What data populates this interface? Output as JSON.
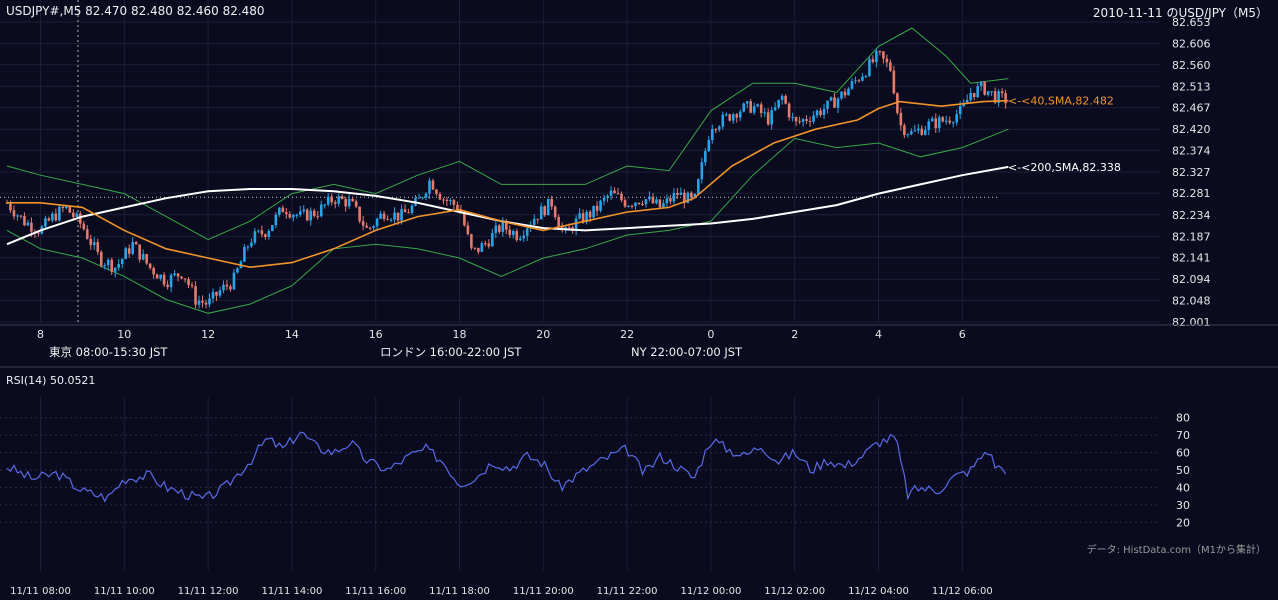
{
  "header": {
    "symbol_line": "USDJPY#,M5 82.470 82.480 82.460 82.480",
    "title": "2010-11-11 のUSD/JPY（M5）"
  },
  "colors": {
    "background": "#0a0b1f",
    "grid": "#1c1f38",
    "up_candle": "#2aa3e6",
    "down_candle": "#e57b6c",
    "sma40": "#f0932b",
    "sma200": "#ffffff",
    "bollinger": "#39a84a",
    "rsi": "#5a6ae6",
    "tokyo": "#25507e",
    "london": "#7e5417",
    "ny": "#27613c"
  },
  "sessions": [
    {
      "label": "東京 08:00-15:30 JST",
      "color": "#25507e"
    },
    {
      "label": "ロンドン 16:00-22:00 JST",
      "color": "#7e5417"
    },
    {
      "label": "NY 22:00-07:00 JST",
      "color": "#27613c"
    }
  ],
  "annotations": {
    "sma40": "<-<40,SMA,82.482",
    "sma200": "<-<200,SMA,82.338"
  },
  "rsi": {
    "label": "RSI(14) 50.0521",
    "ticks": [
      "20",
      "30",
      "40",
      "50",
      "60",
      "70",
      "80"
    ]
  },
  "credit": "データ: HistData.com（M1から集計）",
  "chart_data": [
    {
      "type": "candlestick",
      "title": "2010-11-11 のUSD/JPY（M5）",
      "x_hour_labels": [
        "8",
        "10",
        "12",
        "14",
        "16",
        "18",
        "20",
        "22",
        "0",
        "2",
        "4",
        "6"
      ],
      "y_ticks": [
        "82.653",
        "82.606",
        "82.560",
        "82.513",
        "82.467",
        "82.420",
        "82.374",
        "82.327",
        "82.281",
        "82.234",
        "82.187",
        "82.141",
        "82.094",
        "82.048",
        "82.001"
      ],
      "ylim": [
        82.001,
        82.653
      ],
      "close_path": [
        [
          7.2,
          82.26
        ],
        [
          7.6,
          82.22
        ],
        [
          8.0,
          82.2
        ],
        [
          8.3,
          82.23
        ],
        [
          8.6,
          82.25
        ],
        [
          9.0,
          82.21
        ],
        [
          9.4,
          82.14
        ],
        [
          9.8,
          82.12
        ],
        [
          10.2,
          82.17
        ],
        [
          10.6,
          82.12
        ],
        [
          11.0,
          82.09
        ],
        [
          11.4,
          82.11
        ],
        [
          11.7,
          82.05
        ],
        [
          12.0,
          82.04
        ],
        [
          12.3,
          82.07
        ],
        [
          12.6,
          82.09
        ],
        [
          13.0,
          82.18
        ],
        [
          13.4,
          82.2
        ],
        [
          13.8,
          82.25
        ],
        [
          14.2,
          82.23
        ],
        [
          14.6,
          82.24
        ],
        [
          15.0,
          82.27
        ],
        [
          15.4,
          82.26
        ],
        [
          15.8,
          82.2
        ],
        [
          16.2,
          82.24
        ],
        [
          16.6,
          82.23
        ],
        [
          17.0,
          82.26
        ],
        [
          17.3,
          82.31
        ],
        [
          17.6,
          82.27
        ],
        [
          18.0,
          82.25
        ],
        [
          18.3,
          82.15
        ],
        [
          18.6,
          82.17
        ],
        [
          19.0,
          82.21
        ],
        [
          19.4,
          82.19
        ],
        [
          19.8,
          82.23
        ],
        [
          20.2,
          82.26
        ],
        [
          20.5,
          82.19
        ],
        [
          20.8,
          82.22
        ],
        [
          21.2,
          82.24
        ],
        [
          21.6,
          82.28
        ],
        [
          22.0,
          82.26
        ],
        [
          22.4,
          82.27
        ],
        [
          22.8,
          82.25
        ],
        [
          23.2,
          82.28
        ],
        [
          23.6,
          82.26
        ],
        [
          24.0,
          82.43
        ],
        [
          24.3,
          82.44
        ],
        [
          24.6,
          82.46
        ],
        [
          25.0,
          82.47
        ],
        [
          25.4,
          82.44
        ],
        [
          25.7,
          82.49
        ],
        [
          26.0,
          82.43
        ],
        [
          26.4,
          82.45
        ],
        [
          26.8,
          82.47
        ],
        [
          27.2,
          82.5
        ],
        [
          27.6,
          82.54
        ],
        [
          28.0,
          82.58
        ],
        [
          28.3,
          82.55
        ],
        [
          28.5,
          82.43
        ],
        [
          28.8,
          82.41
        ],
        [
          29.2,
          82.43
        ],
        [
          29.6,
          82.44
        ],
        [
          30.0,
          82.46
        ],
        [
          30.2,
          82.5
        ],
        [
          30.5,
          82.51
        ],
        [
          30.8,
          82.49
        ],
        [
          31.1,
          82.482
        ]
      ],
      "sma40_path": [
        [
          7.2,
          82.26
        ],
        [
          8.0,
          82.26
        ],
        [
          9.0,
          82.25
        ],
        [
          10.0,
          82.2
        ],
        [
          11.0,
          82.16
        ],
        [
          12.0,
          82.14
        ],
        [
          13.0,
          82.12
        ],
        [
          14.0,
          82.13
        ],
        [
          15.0,
          82.16
        ],
        [
          16.0,
          82.2
        ],
        [
          17.0,
          82.23
        ],
        [
          18.0,
          82.245
        ],
        [
          19.0,
          82.22
        ],
        [
          20.0,
          82.2
        ],
        [
          21.0,
          82.22
        ],
        [
          22.0,
          82.24
        ],
        [
          23.0,
          82.25
        ],
        [
          23.6,
          82.27
        ],
        [
          24.5,
          82.34
        ],
        [
          25.5,
          82.39
        ],
        [
          26.5,
          82.42
        ],
        [
          27.5,
          82.44
        ],
        [
          28.0,
          82.465
        ],
        [
          28.5,
          82.48
        ],
        [
          29.5,
          82.47
        ],
        [
          30.5,
          82.48
        ],
        [
          31.1,
          82.482
        ]
      ],
      "sma200_path": [
        [
          7.2,
          82.17
        ],
        [
          8.0,
          82.2
        ],
        [
          9.0,
          82.23
        ],
        [
          10.0,
          82.25
        ],
        [
          11.0,
          82.27
        ],
        [
          12.0,
          82.285
        ],
        [
          13.0,
          82.29
        ],
        [
          14.0,
          82.29
        ],
        [
          15.0,
          82.285
        ],
        [
          16.0,
          82.275
        ],
        [
          17.0,
          82.26
        ],
        [
          18.0,
          82.24
        ],
        [
          19.0,
          82.22
        ],
        [
          20.0,
          82.205
        ],
        [
          21.0,
          82.2
        ],
        [
          22.0,
          82.205
        ],
        [
          23.0,
          82.21
        ],
        [
          24.0,
          82.215
        ],
        [
          25.0,
          82.225
        ],
        [
          26.0,
          82.24
        ],
        [
          27.0,
          82.255
        ],
        [
          28.0,
          82.28
        ],
        [
          29.0,
          82.3
        ],
        [
          30.0,
          82.32
        ],
        [
          31.1,
          82.338
        ]
      ],
      "bollinger_upper_path": [
        [
          7.2,
          82.34
        ],
        [
          8.0,
          82.32
        ],
        [
          9.0,
          82.3
        ],
        [
          10.0,
          82.28
        ],
        [
          11.0,
          82.23
        ],
        [
          12.0,
          82.18
        ],
        [
          13.0,
          82.22
        ],
        [
          14.0,
          82.28
        ],
        [
          15.0,
          82.3
        ],
        [
          16.0,
          82.28
        ],
        [
          17.0,
          82.32
        ],
        [
          18.0,
          82.35
        ],
        [
          19.0,
          82.3
        ],
        [
          20.0,
          82.3
        ],
        [
          21.0,
          82.3
        ],
        [
          22.0,
          82.34
        ],
        [
          23.0,
          82.33
        ],
        [
          24.0,
          82.46
        ],
        [
          25.0,
          82.52
        ],
        [
          26.0,
          82.52
        ],
        [
          27.0,
          82.5
        ],
        [
          28.0,
          82.6
        ],
        [
          28.8,
          82.64
        ],
        [
          29.6,
          82.58
        ],
        [
          30.2,
          82.52
        ],
        [
          31.1,
          82.53
        ]
      ],
      "bollinger_lower_path": [
        [
          7.2,
          82.2
        ],
        [
          8.0,
          82.16
        ],
        [
          9.0,
          82.14
        ],
        [
          10.0,
          82.1
        ],
        [
          11.0,
          82.05
        ],
        [
          12.0,
          82.02
        ],
        [
          13.0,
          82.04
        ],
        [
          14.0,
          82.08
        ],
        [
          15.0,
          82.16
        ],
        [
          16.0,
          82.17
        ],
        [
          17.0,
          82.16
        ],
        [
          18.0,
          82.14
        ],
        [
          19.0,
          82.1
        ],
        [
          20.0,
          82.14
        ],
        [
          21.0,
          82.16
        ],
        [
          22.0,
          82.19
        ],
        [
          23.0,
          82.2
        ],
        [
          24.0,
          82.22
        ],
        [
          25.0,
          82.32
        ],
        [
          26.0,
          82.4
        ],
        [
          27.0,
          82.38
        ],
        [
          28.0,
          82.39
        ],
        [
          29.0,
          82.36
        ],
        [
          30.0,
          82.38
        ],
        [
          31.1,
          82.42
        ]
      ]
    },
    {
      "type": "line",
      "title": "RSI(14) 50.0521",
      "ylim": [
        15,
        85
      ],
      "y_ticks": [
        20,
        30,
        40,
        50,
        60,
        70,
        80
      ],
      "x_tick_labels": [
        "11/11 08:00",
        "11/11 10:00",
        "11/11 12:00",
        "11/11 14:00",
        "11/11 16:00",
        "11/11 18:00",
        "11/11 20:00",
        "11/11 22:00",
        "11/12 00:00",
        "11/12 02:00",
        "11/12 04:00",
        "11/12 06:00"
      ],
      "path": [
        [
          7.2,
          52
        ],
        [
          7.8,
          45
        ],
        [
          8.4,
          48
        ],
        [
          9.0,
          38
        ],
        [
          9.6,
          34
        ],
        [
          10.0,
          45
        ],
        [
          10.6,
          47
        ],
        [
          11.0,
          40
        ],
        [
          11.5,
          36
        ],
        [
          11.9,
          33
        ],
        [
          12.4,
          40
        ],
        [
          13.0,
          55
        ],
        [
          13.4,
          68
        ],
        [
          13.8,
          62
        ],
        [
          14.2,
          72
        ],
        [
          14.6,
          63
        ],
        [
          15.0,
          60
        ],
        [
          15.4,
          66
        ],
        [
          15.8,
          55
        ],
        [
          16.3,
          50
        ],
        [
          16.8,
          58
        ],
        [
          17.2,
          62
        ],
        [
          17.6,
          55
        ],
        [
          18.0,
          42
        ],
        [
          18.4,
          46
        ],
        [
          18.8,
          55
        ],
        [
          19.2,
          51
        ],
        [
          19.6,
          58
        ],
        [
          20.0,
          54
        ],
        [
          20.4,
          40
        ],
        [
          20.8,
          47
        ],
        [
          21.2,
          53
        ],
        [
          21.6,
          58
        ],
        [
          22.0,
          62
        ],
        [
          22.4,
          48
        ],
        [
          22.8,
          58
        ],
        [
          23.2,
          52
        ],
        [
          23.6,
          45
        ],
        [
          24.0,
          68
        ],
        [
          24.4,
          62
        ],
        [
          24.8,
          58
        ],
        [
          25.2,
          64
        ],
        [
          25.6,
          55
        ],
        [
          26.0,
          60
        ],
        [
          26.4,
          50
        ],
        [
          26.8,
          56
        ],
        [
          27.2,
          52
        ],
        [
          27.6,
          58
        ],
        [
          28.0,
          66
        ],
        [
          28.4,
          69
        ],
        [
          28.7,
          36
        ],
        [
          29.0,
          40
        ],
        [
          29.4,
          38
        ],
        [
          29.8,
          46
        ],
        [
          30.2,
          50
        ],
        [
          30.6,
          62
        ],
        [
          30.8,
          52
        ],
        [
          31.1,
          50.05
        ]
      ]
    }
  ]
}
